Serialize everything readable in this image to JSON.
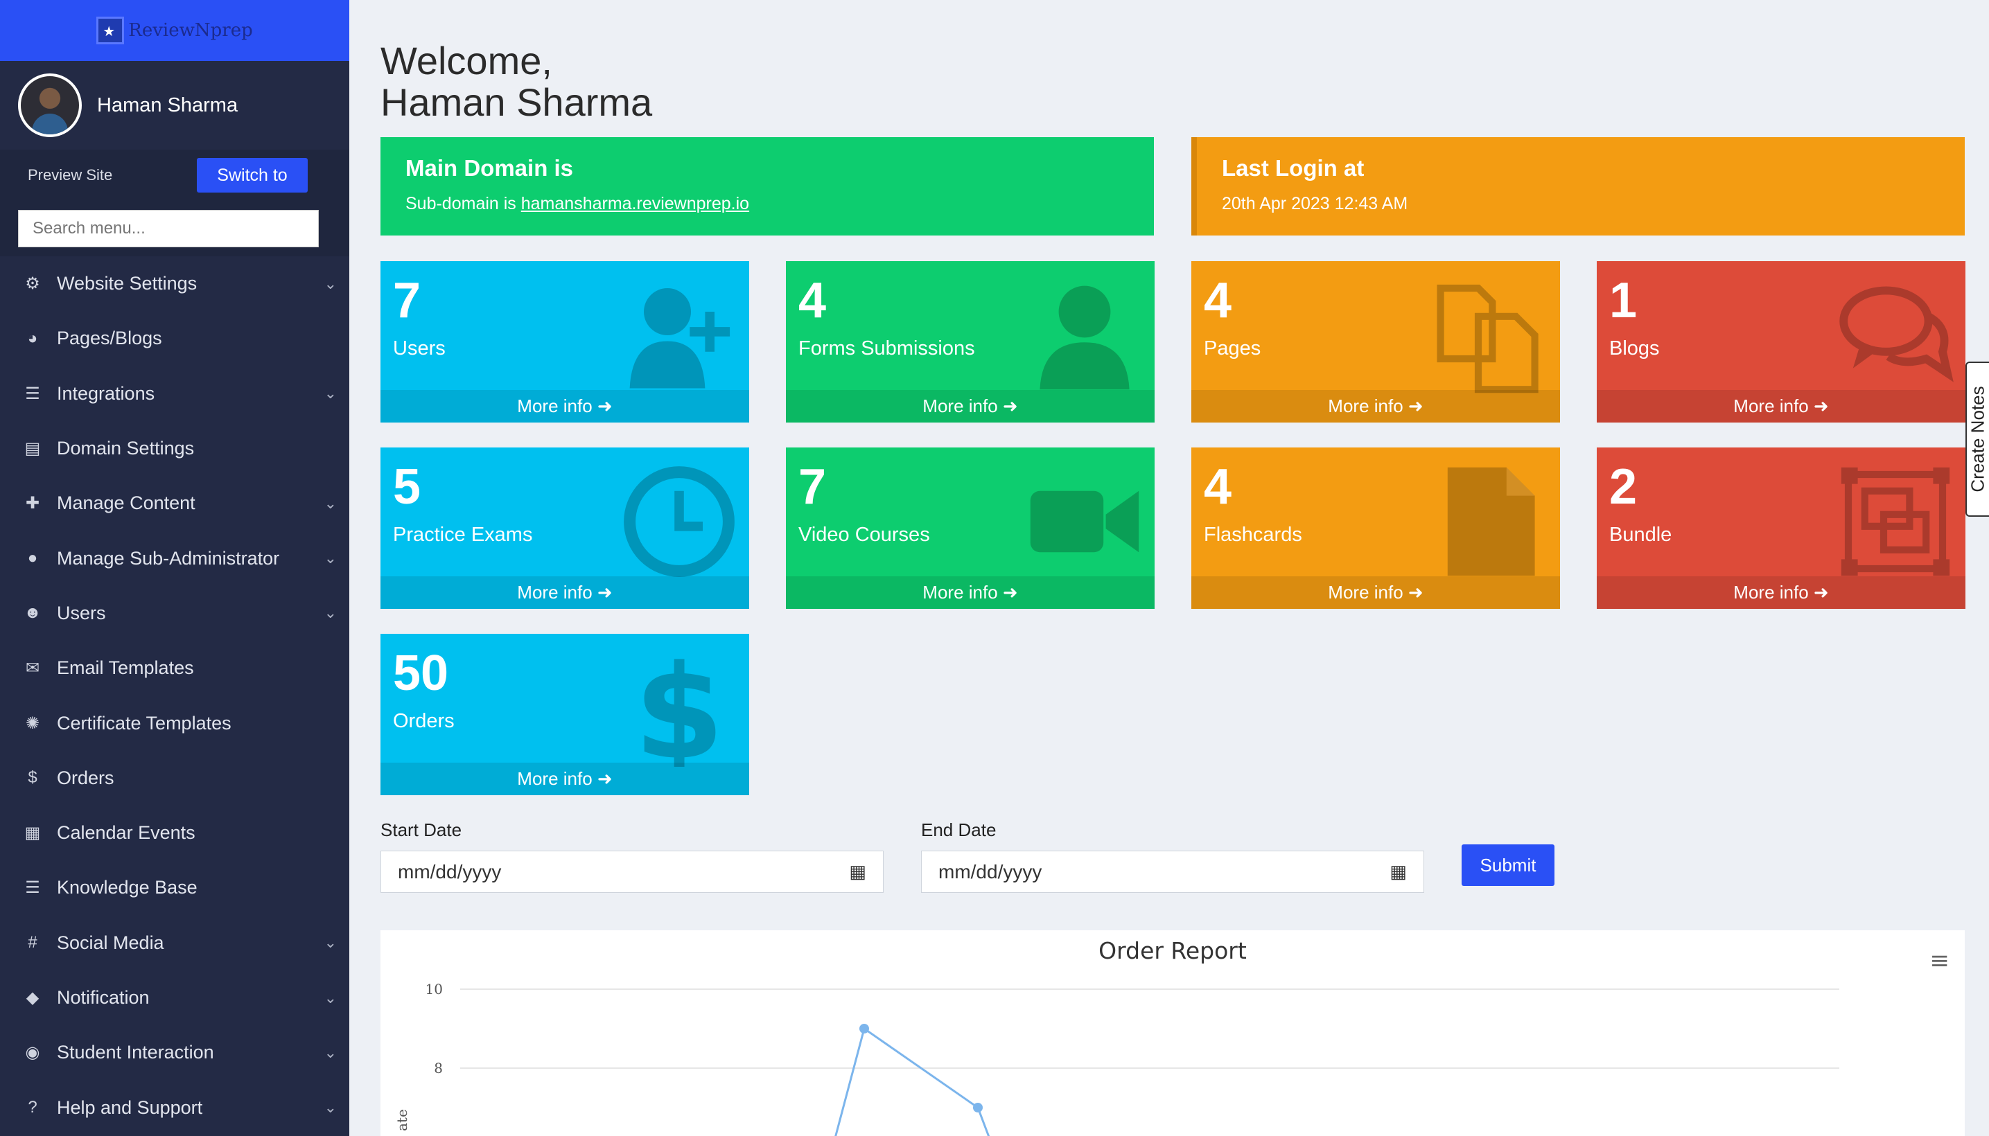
{
  "brand": {
    "logo_text": "ReviewNprep"
  },
  "profile": {
    "name": "Haman Sharma"
  },
  "preview": {
    "label": "Preview Site",
    "switch_label": "Switch to"
  },
  "search": {
    "placeholder": "Search menu..."
  },
  "sidebar": {
    "items": [
      {
        "label": "Website Settings",
        "icon": "gear-icon",
        "glyph": "⚙",
        "has_children": true
      },
      {
        "label": "Pages/Blogs",
        "icon": "palette-icon",
        "glyph": "◕",
        "has_children": false
      },
      {
        "label": "Integrations",
        "icon": "list-icon",
        "glyph": "☰",
        "has_children": true
      },
      {
        "label": "Domain Settings",
        "icon": "window-icon",
        "glyph": "▤",
        "has_children": false
      },
      {
        "label": "Manage Content",
        "icon": "plus-icon",
        "glyph": "✚",
        "has_children": true
      },
      {
        "label": "Manage Sub-Administrator",
        "icon": "user-icon",
        "glyph": "●",
        "has_children": true
      },
      {
        "label": "Users",
        "icon": "user-plus-icon",
        "glyph": "☻",
        "has_children": true
      },
      {
        "label": "Email Templates",
        "icon": "envelope-icon",
        "glyph": "✉",
        "has_children": false
      },
      {
        "label": "Certificate Templates",
        "icon": "certificate-icon",
        "glyph": "✺",
        "has_children": false
      },
      {
        "label": "Orders",
        "icon": "dollar-icon",
        "glyph": "$",
        "has_children": false
      },
      {
        "label": "Calendar Events",
        "icon": "calendar-icon",
        "glyph": "▦",
        "has_children": false
      },
      {
        "label": "Knowledge Base",
        "icon": "list-icon",
        "glyph": "☰",
        "has_children": false
      },
      {
        "label": "Social Media",
        "icon": "hashtag-icon",
        "glyph": "#",
        "has_children": true
      },
      {
        "label": "Notification",
        "icon": "bell-icon",
        "glyph": "◆",
        "has_children": true
      },
      {
        "label": "Student Interaction",
        "icon": "comments-icon",
        "glyph": "◉",
        "has_children": true
      },
      {
        "label": "Help and Support",
        "icon": "question-icon",
        "glyph": "?",
        "has_children": true
      }
    ]
  },
  "welcome": {
    "line1": "Welcome,",
    "line2": "Haman Sharma"
  },
  "domain_box": {
    "title": "Main Domain is",
    "sub_prefix": "Sub-domain is ",
    "sub_link": "hamansharma.reviewnprep.io"
  },
  "login_box": {
    "title": "Last Login at",
    "value": "20th Apr 2023 12:43 AM"
  },
  "cards": [
    {
      "count": "7",
      "label": "Users",
      "more": "More info ➜",
      "color": "#00c0ef",
      "icon": "user-plus-icon"
    },
    {
      "count": "4",
      "label": "Forms Submissions",
      "more": "More info ➜",
      "color": "#0dcd6f",
      "icon": "user-icon"
    },
    {
      "count": "4",
      "label": "Pages",
      "more": "More info ➜",
      "color": "#f39c12",
      "icon": "copy-icon"
    },
    {
      "count": "1",
      "label": "Blogs",
      "more": "More info ➜",
      "color": "#dd4b39",
      "icon": "comments-icon"
    },
    {
      "count": "5",
      "label": "Practice Exams",
      "more": "More info ➜",
      "color": "#00c0ef",
      "icon": "clock-icon"
    },
    {
      "count": "7",
      "label": "Video Courses",
      "more": "More info ➜",
      "color": "#0dcd6f",
      "icon": "video-camera-icon"
    },
    {
      "count": "4",
      "label": "Flashcards",
      "more": "More info ➜",
      "color": "#f39c12",
      "icon": "file-icon"
    },
    {
      "count": "2",
      "label": "Bundle",
      "more": "More info ➜",
      "color": "#dd4b39",
      "icon": "object-group-icon"
    },
    {
      "count": "50",
      "label": "Orders",
      "more": "More info ➜",
      "color": "#00c0ef",
      "icon": "dollar-icon"
    }
  ],
  "filters": {
    "start_label": "Start Date",
    "start_value": "mm/dd/yyyy",
    "end_label": "End Date",
    "end_value": "mm/dd/yyyy",
    "submit_label": "Submit"
  },
  "chart_data": {
    "type": "line",
    "title": "Order Report",
    "ylabel": "ate",
    "y_ticks": [
      10,
      8
    ],
    "ylim": [
      0,
      10
    ],
    "series": [
      {
        "values": [
          {
            "x": 0,
            "y": 9
          },
          {
            "x": 1,
            "y": 7
          }
        ]
      }
    ]
  },
  "notes_tab": {
    "label": "Create Notes"
  }
}
